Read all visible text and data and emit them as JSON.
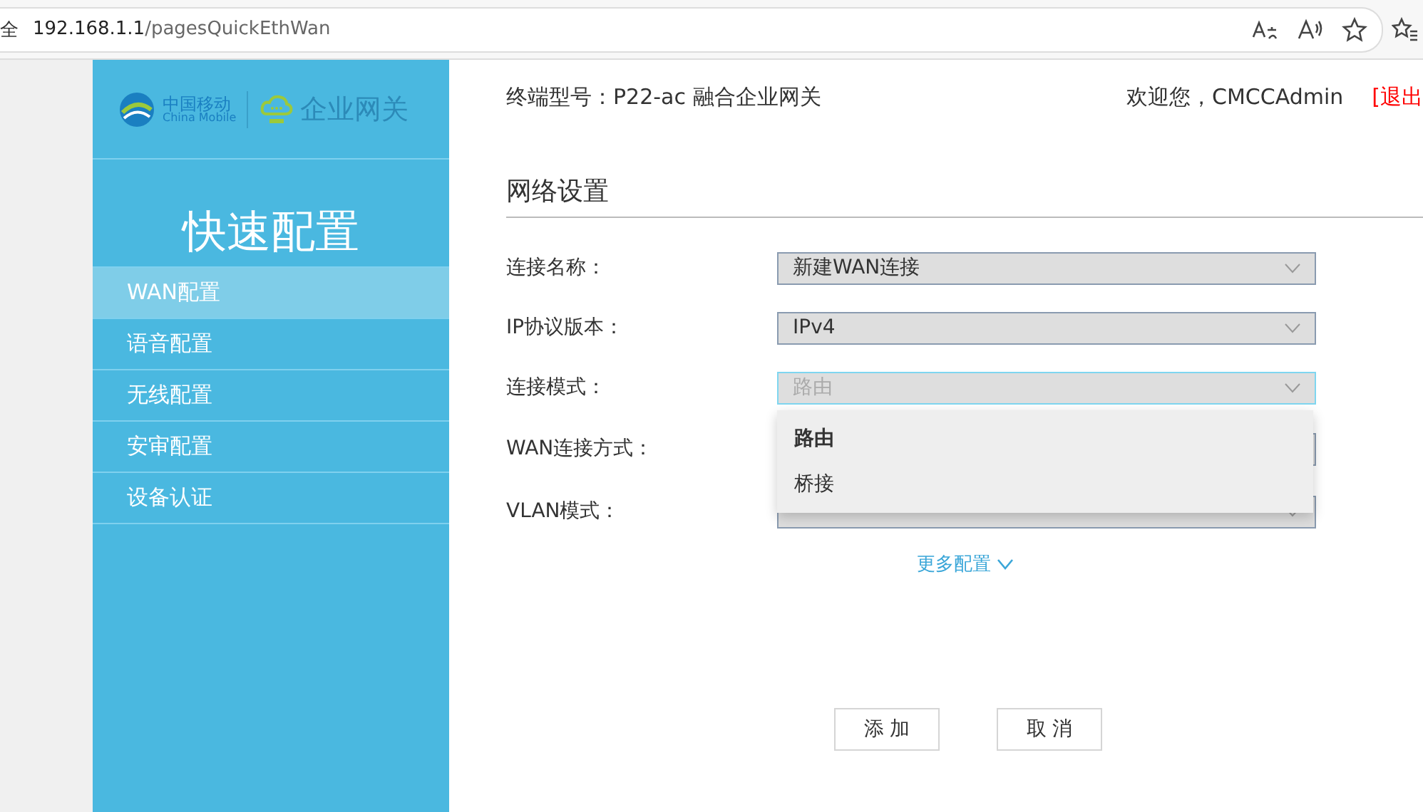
{
  "browser": {
    "security_fragment": "全",
    "url_host": "192.168.1.1",
    "url_path": "/pagesQuickEthWan"
  },
  "sidebar": {
    "logo_cn": "中国移动",
    "logo_en": "China Mobile",
    "logo_product": "企业网关",
    "title": "快速配置",
    "items": [
      {
        "label": "WAN配置",
        "selected": true
      },
      {
        "label": "语音配置",
        "selected": false
      },
      {
        "label": "无线配置",
        "selected": false
      },
      {
        "label": "安审配置",
        "selected": false
      },
      {
        "label": "设备认证",
        "selected": false
      }
    ]
  },
  "header": {
    "model": "终端型号：P22-ac 融合企业网关",
    "welcome": "欢迎您，CMCCAdmin",
    "logout": "[退出"
  },
  "section_title": "网络设置",
  "form": [
    {
      "label": "连接名称：",
      "value": "新建WAN连接",
      "disabled": false
    },
    {
      "label": "IP协议版本：",
      "value": "IPv4",
      "disabled": false
    },
    {
      "label": "连接模式：",
      "value": "路由",
      "disabled": true,
      "open": true
    },
    {
      "label": "WAN连接方式："
    },
    {
      "label": "VLAN模式："
    }
  ],
  "dropdown": [
    {
      "label": "路由",
      "selected": true
    },
    {
      "label": "桥接",
      "selected": false
    }
  ],
  "more_link": "更多配置",
  "buttons": [
    "添 加",
    "取 消"
  ]
}
